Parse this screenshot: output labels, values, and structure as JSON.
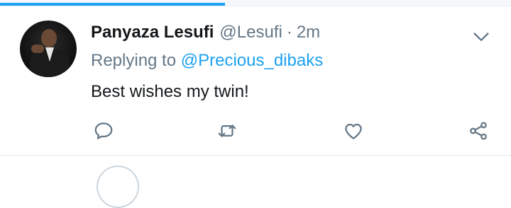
{
  "ui": {
    "accent": "#1da1f2",
    "text_primary": "#14171a",
    "text_secondary": "#657786",
    "load_progress": 0.44
  },
  "tweet": {
    "author_name": "Panyaza Lesufi",
    "author_handle": "@Lesufi",
    "separator": "·",
    "time": "2m",
    "replying_prefix": "Replying to",
    "replying_to": "@Precious_dibaks",
    "text": "Best wishes my twin!",
    "avatar": "author-avatar",
    "actions": [
      {
        "name": "reply",
        "icon": "speech-bubble-icon"
      },
      {
        "name": "retweet",
        "icon": "retweet-icon"
      },
      {
        "name": "like",
        "icon": "heart-icon"
      },
      {
        "name": "share",
        "icon": "share-icon"
      }
    ],
    "menu_icon": "chevron-down-icon"
  }
}
